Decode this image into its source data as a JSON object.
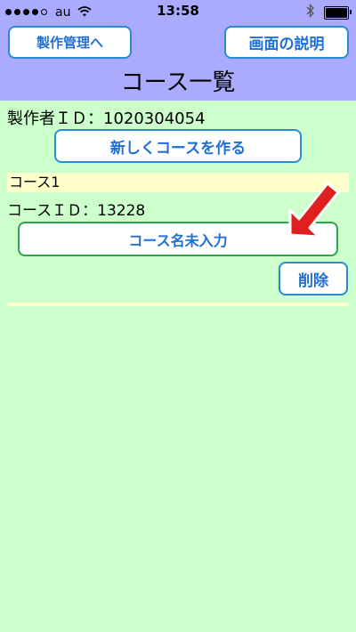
{
  "status_bar": {
    "carrier": "au",
    "time": "13:58",
    "signal_bars": 4,
    "signal_max": 5,
    "battery_level": 1.0
  },
  "header": {
    "back_button": "製作管理へ",
    "help_button": "画面の説明",
    "title": "コース一覧"
  },
  "maker_id": "製作者ＩＤ：1020304054",
  "create_button": "新しくコースを作る",
  "course": {
    "name": "コース1",
    "id_text": "コースＩＤ：13228",
    "name_button": "コース名未入力",
    "delete_button": "削除"
  },
  "colors": {
    "header_bg": "#aaaaff",
    "page_bg": "#ccffcc",
    "highlight_bg": "#ffffcc",
    "button_text": "#1f6fd6",
    "button_border": "#2a8ad8",
    "name_button_border": "#2aa84a",
    "arrow": "#e02020"
  },
  "icons": [
    "wifi-icon",
    "bluetooth-icon",
    "battery-icon",
    "arrow-pointer-icon"
  ]
}
